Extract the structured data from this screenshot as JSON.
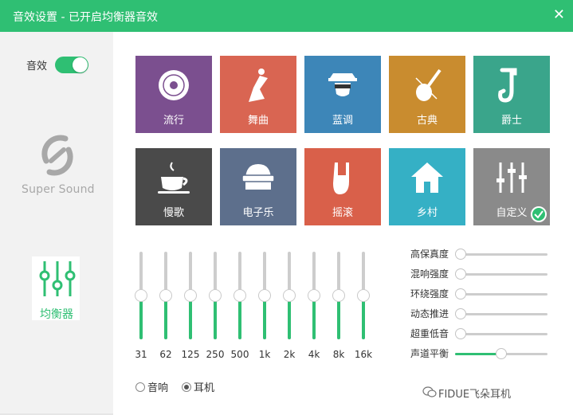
{
  "window": {
    "title": "音效设置 - 已开启均衡器音效",
    "close_icon": "close-icon"
  },
  "colors": {
    "accent": "#2fbf73",
    "sidebar_bg": "#f2f2f2"
  },
  "sidebar": {
    "sound_label": "音效",
    "sound_toggle_on": true,
    "supersound_label": "Super Sound",
    "equalizer_label": "均衡器"
  },
  "presets": [
    {
      "label": "流行",
      "icon": "vinyl-record-icon",
      "color": "#7b4f8f",
      "selected": false
    },
    {
      "label": "舞曲",
      "icon": "dancer-icon",
      "color": "#d96552",
      "selected": false
    },
    {
      "label": "蓝调",
      "icon": "blues-musician-icon",
      "color": "#3d86b8",
      "selected": false
    },
    {
      "label": "古典",
      "icon": "violin-icon",
      "color": "#c98c2f",
      "selected": false
    },
    {
      "label": "爵士",
      "icon": "saxophone-icon",
      "color": "#3aa58b",
      "selected": false
    },
    {
      "label": "慢歌",
      "icon": "coffee-cup-icon",
      "color": "#4a4a4a",
      "selected": false
    },
    {
      "label": "电子乐",
      "icon": "helmet-icon",
      "color": "#5d6f8c",
      "selected": false
    },
    {
      "label": "摇滚",
      "icon": "rock-hand-icon",
      "color": "#d9604a",
      "selected": false
    },
    {
      "label": "乡村",
      "icon": "house-icon",
      "color": "#35b0c5",
      "selected": false
    },
    {
      "label": "自定义",
      "icon": "sliders-icon",
      "color": "#8a8a8a",
      "selected": true
    }
  ],
  "equalizer": {
    "bands": [
      "31",
      "62",
      "125",
      "250",
      "500",
      "1k",
      "2k",
      "4k",
      "8k",
      "16k"
    ],
    "levels": [
      0.5,
      0.5,
      0.5,
      0.5,
      0.5,
      0.5,
      0.5,
      0.5,
      0.5,
      0.5
    ]
  },
  "output_mode": {
    "options": [
      {
        "label": "音响",
        "checked": false
      },
      {
        "label": "耳机",
        "checked": true
      }
    ]
  },
  "effects": [
    {
      "label": "高保真度",
      "value": 0.0
    },
    {
      "label": "混响强度",
      "value": 0.0
    },
    {
      "label": "环绕强度",
      "value": 0.0
    },
    {
      "label": "动态推进",
      "value": 0.0
    },
    {
      "label": "超重低音",
      "value": 0.0
    },
    {
      "label": "声道平衡",
      "value": 0.5
    }
  ],
  "watermark": {
    "text": "FIDUE飞朵耳机",
    "icon": "wechat-icon"
  }
}
